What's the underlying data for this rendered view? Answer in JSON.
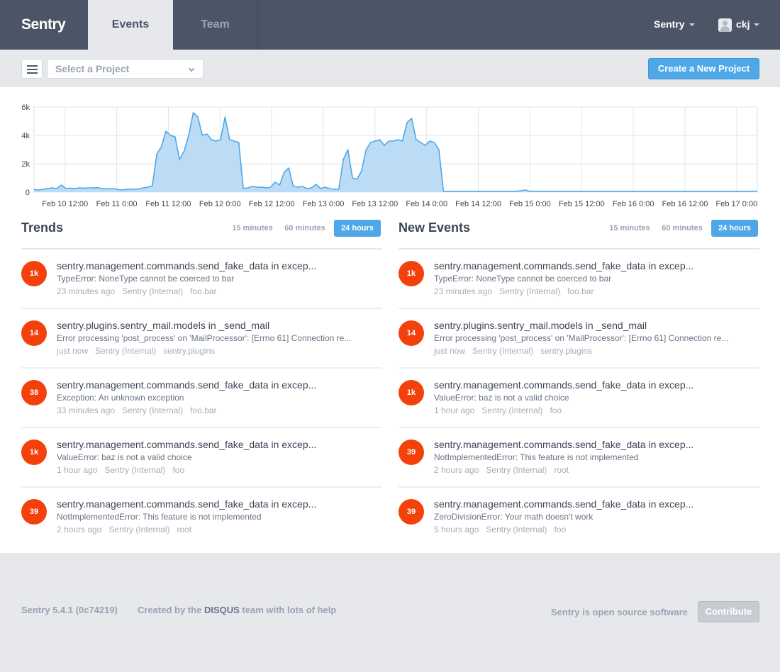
{
  "header": {
    "brand": "Sentry",
    "tabs": [
      {
        "label": "Events",
        "active": true
      },
      {
        "label": "Team",
        "active": false
      }
    ],
    "org_menu": "Sentry",
    "user_menu": "ckj"
  },
  "toolbar": {
    "project_placeholder": "Select a Project",
    "create_button": "Create a New Project"
  },
  "chart_data": {
    "type": "area",
    "x_labels": [
      "Feb 10 12:00",
      "Feb 11 0:00",
      "Feb 11 12:00",
      "Feb 12 0:00",
      "Feb 12 12:00",
      "Feb 13 0:00",
      "Feb 13 12:00",
      "Feb 14 0:00",
      "Feb 14 12:00",
      "Feb 15 0:00",
      "Feb 15 12:00",
      "Feb 16 0:00",
      "Feb 16 12:00",
      "Feb 17 0:00"
    ],
    "y_ticks": [
      "0",
      "2k",
      "4k",
      "6k"
    ],
    "ylim": [
      0,
      6000
    ],
    "grid": true,
    "color": "#4ea8e8",
    "fill": "#bcdcf5",
    "values": [
      180,
      150,
      200,
      250,
      300,
      250,
      500,
      250,
      280,
      250,
      300,
      280,
      300,
      300,
      320,
      250,
      230,
      250,
      220,
      150,
      180,
      200,
      200,
      220,
      300,
      350,
      450,
      2700,
      3200,
      4300,
      4000,
      3900,
      2300,
      2900,
      4000,
      5600,
      5300,
      4000,
      4100,
      3700,
      3600,
      3700,
      5300,
      3700,
      3600,
      3500,
      250,
      300,
      400,
      350,
      350,
      300,
      350,
      700,
      500,
      1400,
      1700,
      400,
      350,
      400,
      250,
      300,
      550,
      250,
      350,
      250,
      200,
      200,
      2300,
      3000,
      1000,
      900,
      1500,
      3000,
      3500,
      3600,
      3700,
      3300,
      3600,
      3600,
      3700,
      3600,
      4900,
      5200,
      3700,
      3500,
      3300,
      3600,
      3500,
      3000,
      50,
      50,
      50,
      50,
      50,
      50,
      50,
      50,
      50,
      50,
      50,
      50,
      50,
      50,
      50,
      50,
      50,
      100,
      150,
      50,
      50,
      50,
      50,
      50,
      50,
      50,
      50,
      50,
      50,
      50,
      50,
      50,
      50,
      50,
      50,
      50,
      50,
      50,
      50,
      50,
      50,
      50,
      50,
      50,
      50,
      50,
      50,
      50,
      50,
      50,
      50,
      50,
      50,
      50,
      50,
      50,
      50,
      50,
      50,
      50,
      50,
      50,
      50,
      50,
      50,
      50,
      50,
      50,
      50,
      50
    ]
  },
  "trends": {
    "title": "Trends",
    "ranges": [
      "15 minutes",
      "60 minutes",
      "24 hours"
    ],
    "active_range": "24 hours",
    "events": [
      {
        "count": "1k",
        "title": "sentry.management.commands.send_fake_data in excep...",
        "message": "TypeError: NoneType cannot be coerced to bar",
        "time": "23 minutes ago",
        "project": "Sentry (Internal)",
        "tag": "foo.bar"
      },
      {
        "count": "14",
        "title": "sentry.plugins.sentry_mail.models in _send_mail",
        "message": "Error processing 'post_process' on 'MailProcessor': [Errno 61] Connection re...",
        "time": "just now",
        "project": "Sentry (Internal)",
        "tag": "sentry.plugins"
      },
      {
        "count": "38",
        "title": "sentry.management.commands.send_fake_data in excep...",
        "message": "Exception: An unknown exception",
        "time": "33 minutes ago",
        "project": "Sentry (Internal)",
        "tag": "foo.bar"
      },
      {
        "count": "1k",
        "title": "sentry.management.commands.send_fake_data in excep...",
        "message": "ValueError: baz is not a valid choice",
        "time": "1 hour ago",
        "project": "Sentry (Internal)",
        "tag": "foo"
      },
      {
        "count": "39",
        "title": "sentry.management.commands.send_fake_data in excep...",
        "message": "NotImplementedError: This feature is not implemented",
        "time": "2 hours ago",
        "project": "Sentry (Internal)",
        "tag": "root"
      }
    ]
  },
  "new_events": {
    "title": "New Events",
    "ranges": [
      "15 minutes",
      "60 minutes",
      "24 hours"
    ],
    "active_range": "24 hours",
    "events": [
      {
        "count": "1k",
        "title": "sentry.management.commands.send_fake_data in excep...",
        "message": "TypeError: NoneType cannot be coerced to bar",
        "time": "23 minutes ago",
        "project": "Sentry (Internal)",
        "tag": "foo.bar"
      },
      {
        "count": "14",
        "title": "sentry.plugins.sentry_mail.models in _send_mail",
        "message": "Error processing 'post_process' on 'MailProcessor': [Errno 61] Connection re...",
        "time": "just now",
        "project": "Sentry (Internal)",
        "tag": "sentry.plugins"
      },
      {
        "count": "1k",
        "title": "sentry.management.commands.send_fake_data in excep...",
        "message": "ValueError: baz is not a valid choice",
        "time": "1 hour ago",
        "project": "Sentry (Internal)",
        "tag": "foo"
      },
      {
        "count": "39",
        "title": "sentry.management.commands.send_fake_data in excep...",
        "message": "NotImplementedError: This feature is not implemented",
        "time": "2 hours ago",
        "project": "Sentry (Internal)",
        "tag": "root"
      },
      {
        "count": "39",
        "title": "sentry.management.commands.send_fake_data in excep...",
        "message": "ZeroDivisionError: Your math doesn't work",
        "time": "5 hours ago",
        "project": "Sentry (Internal)",
        "tag": "foo"
      }
    ]
  },
  "footer": {
    "version": "Sentry 5.4.1 (0c74219)",
    "credit_prefix": "Created by the",
    "credit_brand": "DISQUS",
    "credit_suffix": "team with lots of help",
    "oss_text": "Sentry is open source software",
    "contribute_button": "Contribute"
  }
}
